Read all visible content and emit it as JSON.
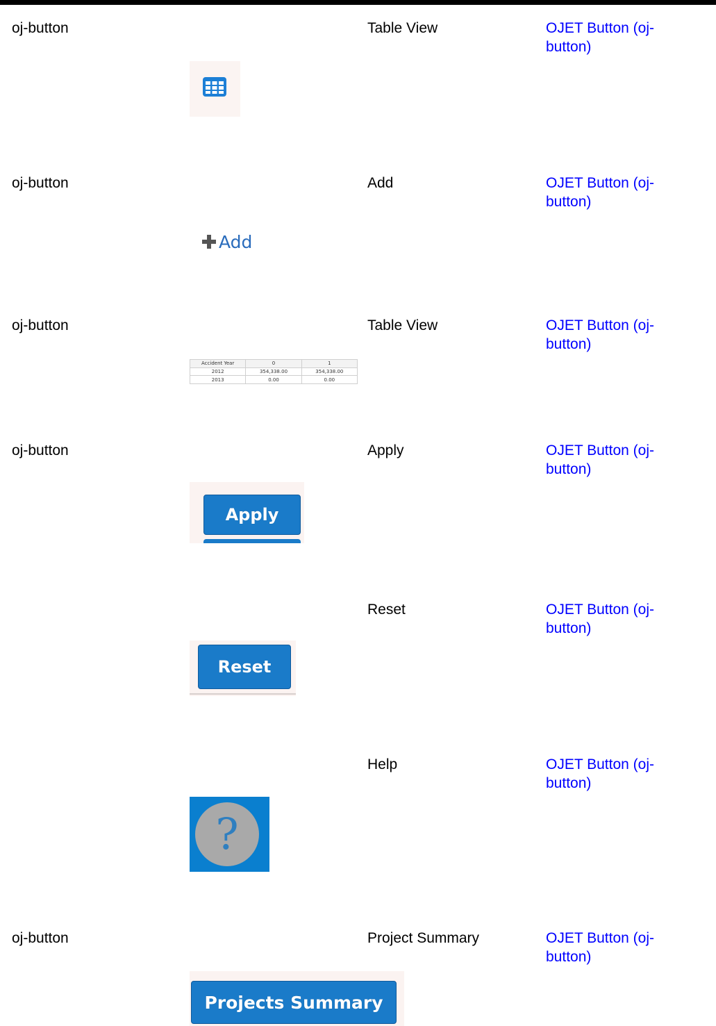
{
  "rows": [
    {
      "component": "oj-button",
      "label": "Table View",
      "link_line1": "OJET Button (oj-",
      "link_line2": "button)",
      "image_icon": "table-grid-icon"
    },
    {
      "component": "oj-button",
      "label": "Add",
      "link_line1": "OJET Button (oj-",
      "link_line2": "button)",
      "image_text": "Add",
      "image_icon": "plus-icon"
    },
    {
      "component": "oj-button",
      "label": "Table View",
      "link_line1": "OJET Button (oj-",
      "link_line2": "button)",
      "mini_table": {
        "headers": [
          "Accident Year",
          "0",
          "1"
        ],
        "rows": [
          [
            "2012",
            "354,338.00",
            "354,338.00"
          ],
          [
            "2013",
            "0.00",
            "0.00"
          ]
        ]
      }
    },
    {
      "component": "oj-button",
      "label": "Apply",
      "link_line1": "OJET Button (oj-",
      "link_line2": "button)",
      "image_text": "Apply"
    },
    {
      "component": "",
      "label": "Reset",
      "link_line1": "OJET Button (oj-",
      "link_line2": "button)",
      "image_text": "Reset"
    },
    {
      "component": "",
      "label": "Help",
      "link_line1": "OJET Button (oj-",
      "link_line2": "button)",
      "image_text": "?",
      "image_icon": "help-question-icon"
    },
    {
      "component": "oj-button",
      "label": "Project Summary",
      "link_line1": "OJET Button (oj-",
      "link_line2": "button)",
      "image_text": "Projects Summary"
    }
  ],
  "colors": {
    "link": "#0000ff",
    "button_blue": "#1a7bc9",
    "help_background": "#0a7fcf"
  }
}
